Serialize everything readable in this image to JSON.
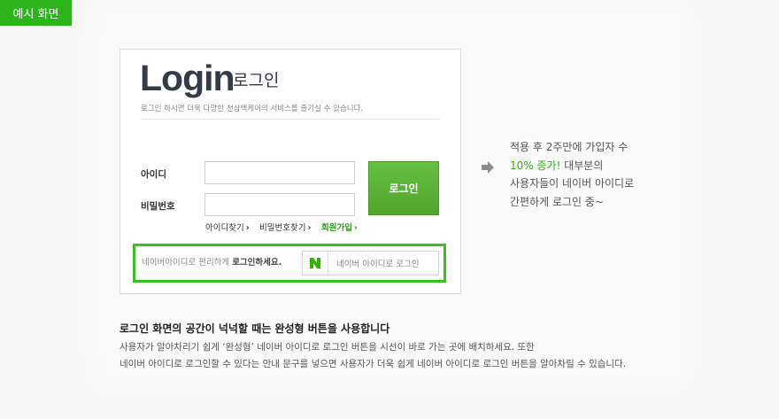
{
  "tag": {
    "label": "예시 화면"
  },
  "login": {
    "title": "Login",
    "subtitle": "로그인",
    "description": "로그인 하시면 더욱 다양한 천삼백케이의 서비스를 즐기실 수 있습니다.",
    "id_label": "아이디",
    "pw_label": "비밀번호",
    "id_value": "",
    "pw_value": "",
    "button_label": "로그인",
    "find_id": "아이디찾기",
    "find_pw": "비밀번호찾기",
    "signup": "회원가입",
    "chevron": "›"
  },
  "naver": {
    "promo_prefix": "네이버아이디로 편리하게 ",
    "promo_bold": "로그인하세요.",
    "logo_letter": "N",
    "button_label": "네이버 아이디로 로그인"
  },
  "side_note": {
    "line1": "적용 후 2주만에 가입자 수",
    "line2_highlight": "10% 증가!",
    "line2_rest": " 대부분의",
    "line3": "사용자들이 네이버 아이디로",
    "line4": "간편하게 로그인 중~"
  },
  "bottom": {
    "heading": "로그인 화면의 공간이 넉넉할 때는 완성형 버튼을 사용합니다",
    "line1": "사용자가 알아차리기 쉽게 ‘완성형’ 네이버 아이디로 로그인 버튼을 시선이 바로 가는 곳에 배치하세요. 또한",
    "line2": "네이버 아이디로 로그인할 수 있다는 안내 문구를 넣으면 사용자가 더욱 쉽게 네이버 아이디로 로그인 버튼을  알아차릴 수 있습니다."
  },
  "colors": {
    "brand_green": "#2bb51b",
    "naver_green": "#36c21f",
    "title_navy": "#343a48"
  },
  "icons": {
    "arrow": "arrow-right-icon",
    "naver": "naver-logo-icon"
  }
}
